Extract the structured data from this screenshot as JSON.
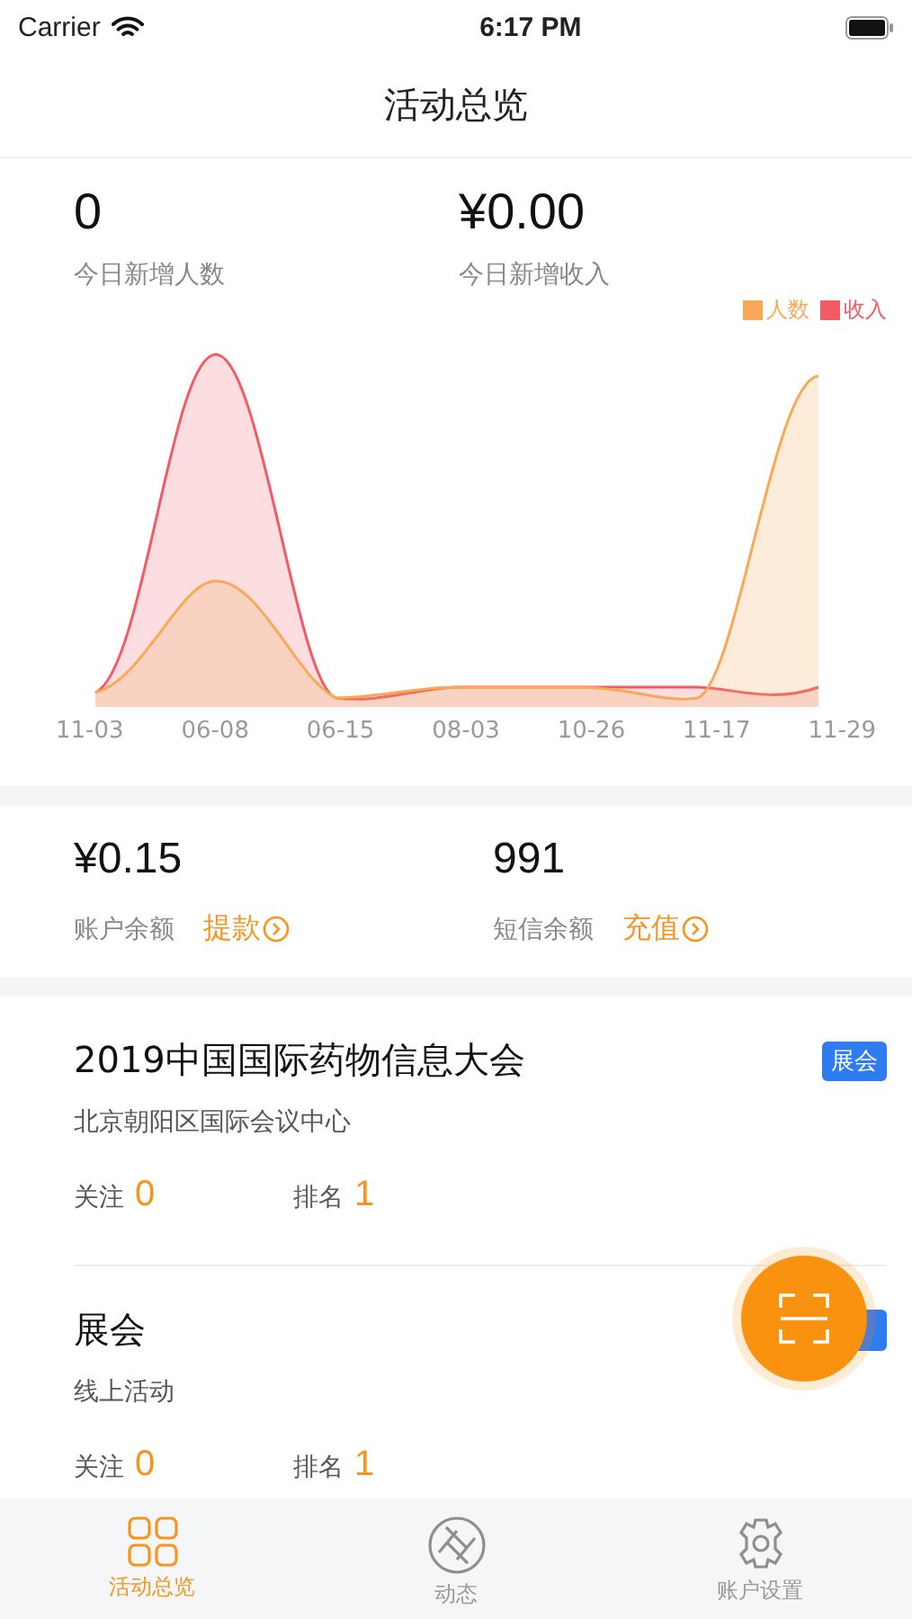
{
  "status_bar": {
    "carrier": "Carrier",
    "time": "6:17 PM"
  },
  "nav_bar": {
    "title": "活动总览"
  },
  "today": [
    {
      "value": "0",
      "label": "今日新增人数"
    },
    {
      "value": "¥0.00",
      "label": "今日新增收入"
    }
  ],
  "chart": {
    "legend": [
      {
        "label": "人数",
        "color": "#f8a957"
      },
      {
        "label": "收入",
        "color": "#f25a64"
      }
    ],
    "x_labels": [
      "11-03",
      "06-08",
      "06-15",
      "08-03",
      "10-26",
      "11-17",
      "11-29"
    ]
  },
  "balances": [
    {
      "value": "¥0.15",
      "label": "账户余额",
      "action": "提款"
    },
    {
      "value": "991",
      "label": "短信余额",
      "action": "充值"
    }
  ],
  "events": [
    {
      "title": "2019中国国际药物信息大会",
      "subtitle": "北京朝阳区国际会议中心",
      "badge": "展会",
      "stats": [
        {
          "label": "关注",
          "value": "0"
        },
        {
          "label": "排名",
          "value": "1"
        }
      ]
    },
    {
      "title": "展会",
      "subtitle": "线上活动",
      "tag_covered": true,
      "stats": [
        {
          "label": "关注",
          "value": "0"
        },
        {
          "label": "排名",
          "value": "1"
        }
      ]
    }
  ],
  "tabs": [
    {
      "label": "活动总览",
      "kind": "grid",
      "selected": true
    },
    {
      "label": "动态",
      "kind": "aperture",
      "selected": false
    },
    {
      "label": "账户设置",
      "kind": "gear",
      "selected": false
    }
  ]
}
